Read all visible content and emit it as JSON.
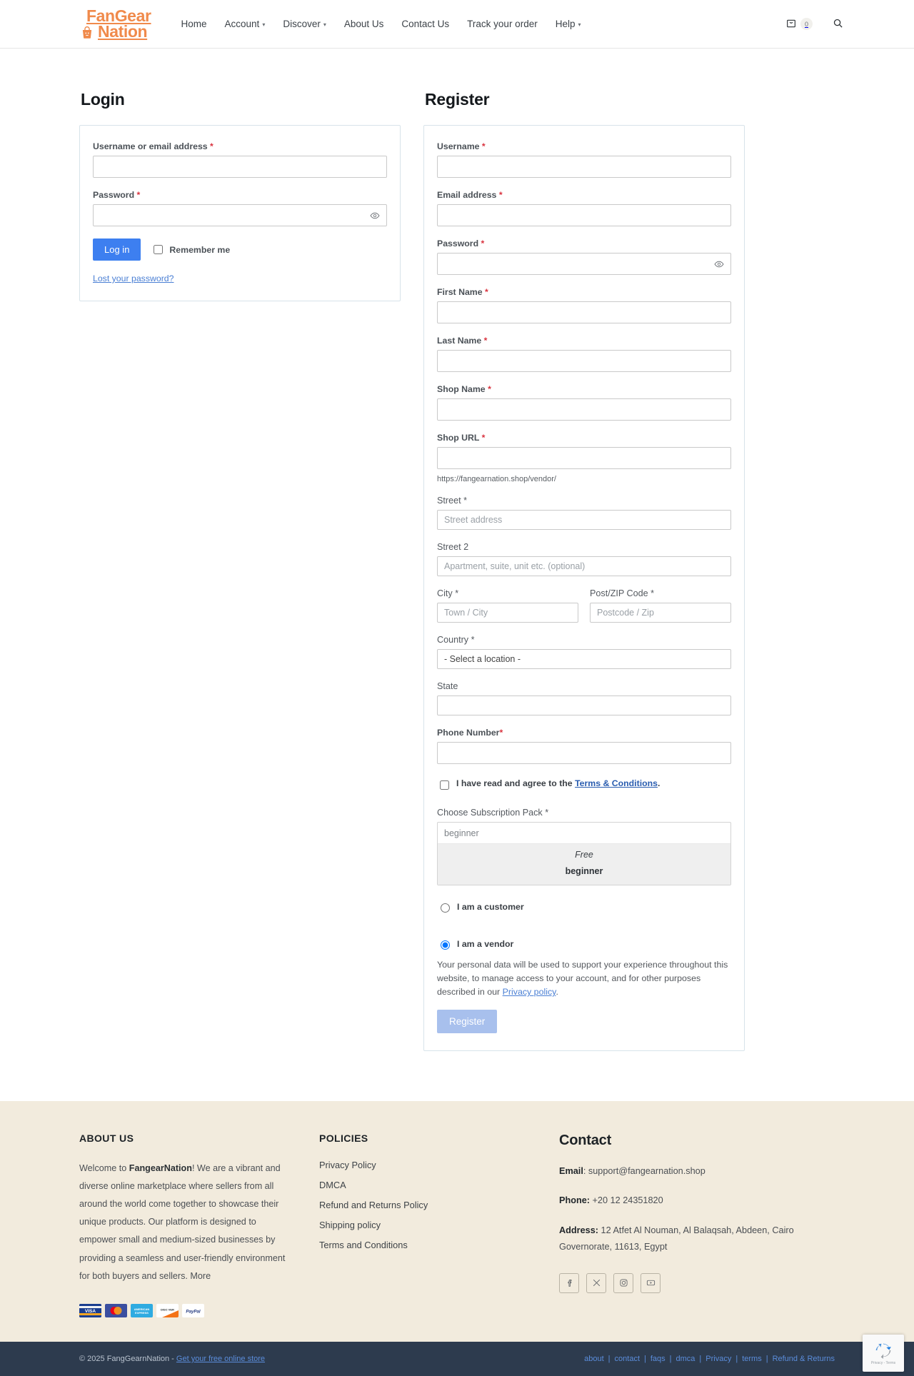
{
  "header": {
    "logo": {
      "line1": "FanGear",
      "line2": "Nation",
      "icon": "shopping-bag-icon",
      "color": "#F08A4B"
    },
    "nav": [
      {
        "label": "Home",
        "has_dropdown": false
      },
      {
        "label": "Account",
        "has_dropdown": true
      },
      {
        "label": "Discover",
        "has_dropdown": true
      },
      {
        "label": "About Us",
        "has_dropdown": false
      },
      {
        "label": "Contact Us",
        "has_dropdown": false
      },
      {
        "label": "Track your order",
        "has_dropdown": false
      },
      {
        "label": "Help",
        "has_dropdown": true
      }
    ],
    "cart": {
      "icon": "shopping-bag-icon",
      "count": "0"
    },
    "search": {
      "icon": "search-icon"
    }
  },
  "login": {
    "title": "Login",
    "username_label": "Username or email address",
    "username_value": "",
    "password_label": "Password",
    "password_value": "",
    "password_toggle_icon": "eye-icon",
    "submit_label": "Log in",
    "remember_label": "Remember me",
    "lost_password_label": "Lost your password?",
    "required_mark": "*"
  },
  "register": {
    "title": "Register",
    "required_mark": "*",
    "fields": {
      "username_label": "Username",
      "email_label": "Email address",
      "password_label": "Password",
      "password_toggle_icon": "eye-icon",
      "first_name_label": "First Name",
      "last_name_label": "Last Name",
      "shop_name_label": "Shop Name",
      "shop_url_label": "Shop URL",
      "shop_url_help": "https://fangearnation.shop/vendor/",
      "street_label": "Street *",
      "street_placeholder": "Street address",
      "street2_label": "Street 2",
      "street2_placeholder": "Apartment, suite, unit etc. (optional)",
      "city_label": "City *",
      "city_placeholder": "Town / City",
      "zip_label": "Post/ZIP Code *",
      "zip_placeholder": "Postcode / Zip",
      "country_label": "Country *",
      "country_value": "- Select a location -",
      "state_label": "State",
      "state_value": "",
      "phone_label": "Phone Number"
    },
    "terms": {
      "text_before": "I have read and agree to the ",
      "link": "Terms & Conditions",
      "text_after": ".",
      "checked": false
    },
    "subscription": {
      "label": "Choose Subscription Pack *",
      "selected": "beginner",
      "price": "Free",
      "pack_name": "beginner"
    },
    "role_customer": "I am a customer",
    "role_vendor": "I am a vendor",
    "selected_role": "vendor",
    "privacy_note_1": "Your personal data will be used to support your experience throughout this website, to manage access to your account, and for other purposes described in our ",
    "privacy_link": "Privacy policy",
    "privacy_note_2": ".",
    "submit_label": "Register"
  },
  "footer": {
    "about": {
      "heading": "ABOUT US",
      "text_1": "Welcome to ",
      "brand": "FangearNation",
      "text_2": "! We are a vibrant and diverse online marketplace where sellers from all around the world come together to showcase their unique products. Our platform is designed to empower small and medium-sized businesses by providing a seamless and user-friendly environment for both buyers and sellers. More",
      "payments": [
        "VISA",
        "MASTERCARD",
        "AMERICAN EXPRESS",
        "DISCOVER",
        "PayPal"
      ]
    },
    "policies": {
      "heading": "POLICIES",
      "links": [
        "Privacy Policy",
        "DMCA",
        "Refund and Returns Policy",
        "Shipping policy",
        "Terms and Conditions"
      ]
    },
    "contact": {
      "heading": "Contact",
      "email_label": "Email",
      "email_value": ": support@fangearnation.shop",
      "phone_label": "Phone:",
      "phone_value": " +20 12 24351820",
      "address_label": "Address:",
      "address_value": " 12 Atfet Al Nouman, Al Balaqsah, Abdeen, Cairo Governorate, 11613, Egypt",
      "socials": [
        "facebook-icon",
        "x-twitter-icon",
        "instagram-icon",
        "youtube-icon"
      ]
    }
  },
  "bottombar": {
    "copyright": "© 2025 FangGearnNation - ",
    "store_link": "Get your free online store",
    "links": [
      "about",
      "contact",
      "faqs",
      "dmca",
      "Privacy",
      "terms",
      "Refund & Returns"
    ],
    "separator": "|",
    "recaptcha_text": "Privacy - Terms"
  }
}
